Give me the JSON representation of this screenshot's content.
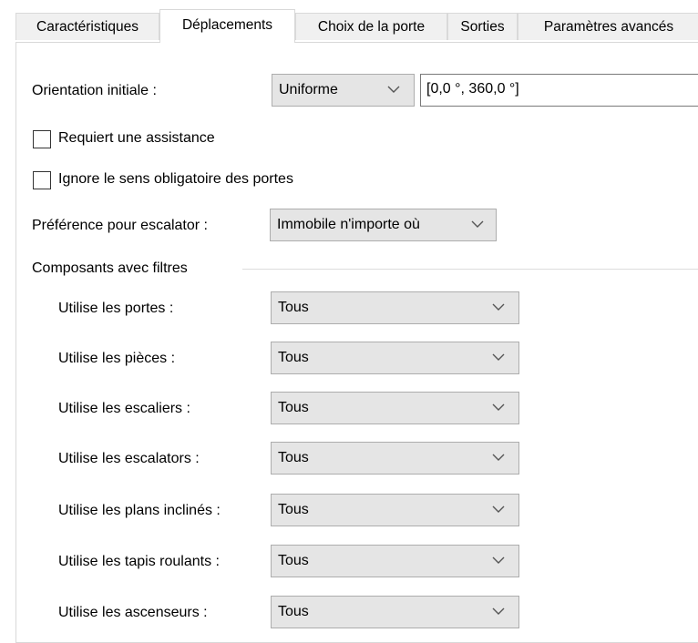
{
  "tabs": [
    {
      "label": "Caractéristiques"
    },
    {
      "label": "Déplacements"
    },
    {
      "label": "Choix de la porte"
    },
    {
      "label": "Sorties"
    },
    {
      "label": "Paramètres avancés"
    }
  ],
  "orientation": {
    "label": "Orientation initiale :",
    "selected": "Uniforme",
    "range_value": "[0,0 °, 360,0 °]"
  },
  "assistance": {
    "label": "Requiert une assistance",
    "checked": false
  },
  "ignore_door_direction": {
    "label": "Ignore le sens obligatoire des portes",
    "checked": false
  },
  "escalator_pref": {
    "label": "Préférence pour escalator :",
    "selected": "Immobile n'importe où"
  },
  "filters_group": {
    "title": "Composants avec filtres",
    "rows": [
      {
        "label": "Utilise les portes :",
        "value": "Tous"
      },
      {
        "label": "Utilise les pièces :",
        "value": "Tous"
      },
      {
        "label": "Utilise les escaliers :",
        "value": "Tous"
      },
      {
        "label": "Utilise les escalators :",
        "value": "Tous"
      },
      {
        "label": "Utilise les plans inclinés :",
        "value": "Tous"
      },
      {
        "label": "Utilise les tapis roulants :",
        "value": "Tous"
      },
      {
        "label": "Utilise les ascenseurs :",
        "value": "Tous"
      }
    ]
  },
  "icons": {
    "dropdown": "chevron-down-icon",
    "checkbox": "checkbox-unchecked"
  }
}
